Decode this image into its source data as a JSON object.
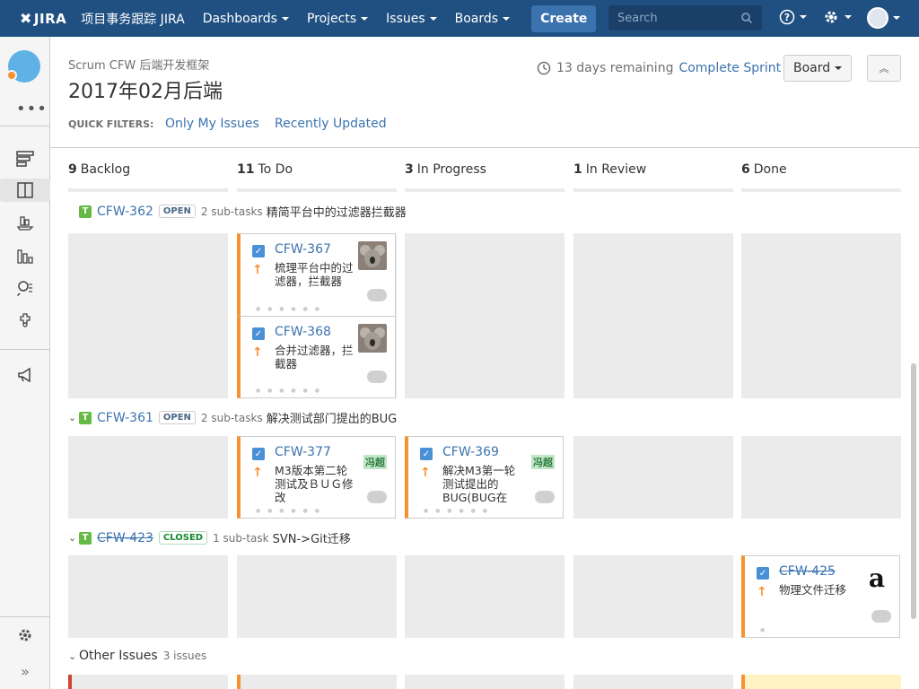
{
  "topnav": {
    "logo": "JIRA",
    "app_name": "项目事务跟踪 JIRA",
    "menus": [
      "Dashboards",
      "Projects",
      "Issues",
      "Boards"
    ],
    "create": "Create",
    "search_placeholder": "Search"
  },
  "header": {
    "project": "Scrum CFW 后端开发框架",
    "title": "2017年02月后端",
    "remaining": "13 days remaining",
    "complete_sprint": "Complete Sprint",
    "board_button": "Board",
    "quick_filters_label": "QUICK FILTERS:",
    "quick_filters": [
      "Only My Issues",
      "Recently Updated"
    ]
  },
  "columns": [
    {
      "count": "9",
      "name": "Backlog"
    },
    {
      "count": "11",
      "name": "To Do"
    },
    {
      "count": "3",
      "name": "In Progress"
    },
    {
      "count": "1",
      "name": "In Review"
    },
    {
      "count": "6",
      "name": "Done"
    }
  ],
  "lanes": [
    {
      "key": "CFW-362",
      "status": "OPEN",
      "subtasks": "2 sub-tasks",
      "title": "精简平台中的过滤器拦截器"
    },
    {
      "key": "CFW-361",
      "status": "OPEN",
      "subtasks": "2 sub-tasks",
      "title": "解决测试部门提出的BUG"
    },
    {
      "key": "CFW-423",
      "status": "CLOSED",
      "subtasks": "1 sub-task",
      "title": "SVN->Git迁移"
    }
  ],
  "other_issues": {
    "label": "Other Issues",
    "count": "3 issues"
  },
  "cards": [
    {
      "key": "CFW-367",
      "summary": "梳理平台中的过滤器，拦截器"
    },
    {
      "key": "CFW-368",
      "summary": "合并过滤器，拦截器"
    },
    {
      "key": "CFW-377",
      "summary": "M3版本第二轮测试及ＢＵＧ修改",
      "badge": "冯超"
    },
    {
      "key": "CFW-369",
      "summary": "解决M3第一轮测试提出的BUG(BUG在",
      "badge": "冯超"
    },
    {
      "key": "CFW-425",
      "summary": "物理文件迁移"
    }
  ]
}
